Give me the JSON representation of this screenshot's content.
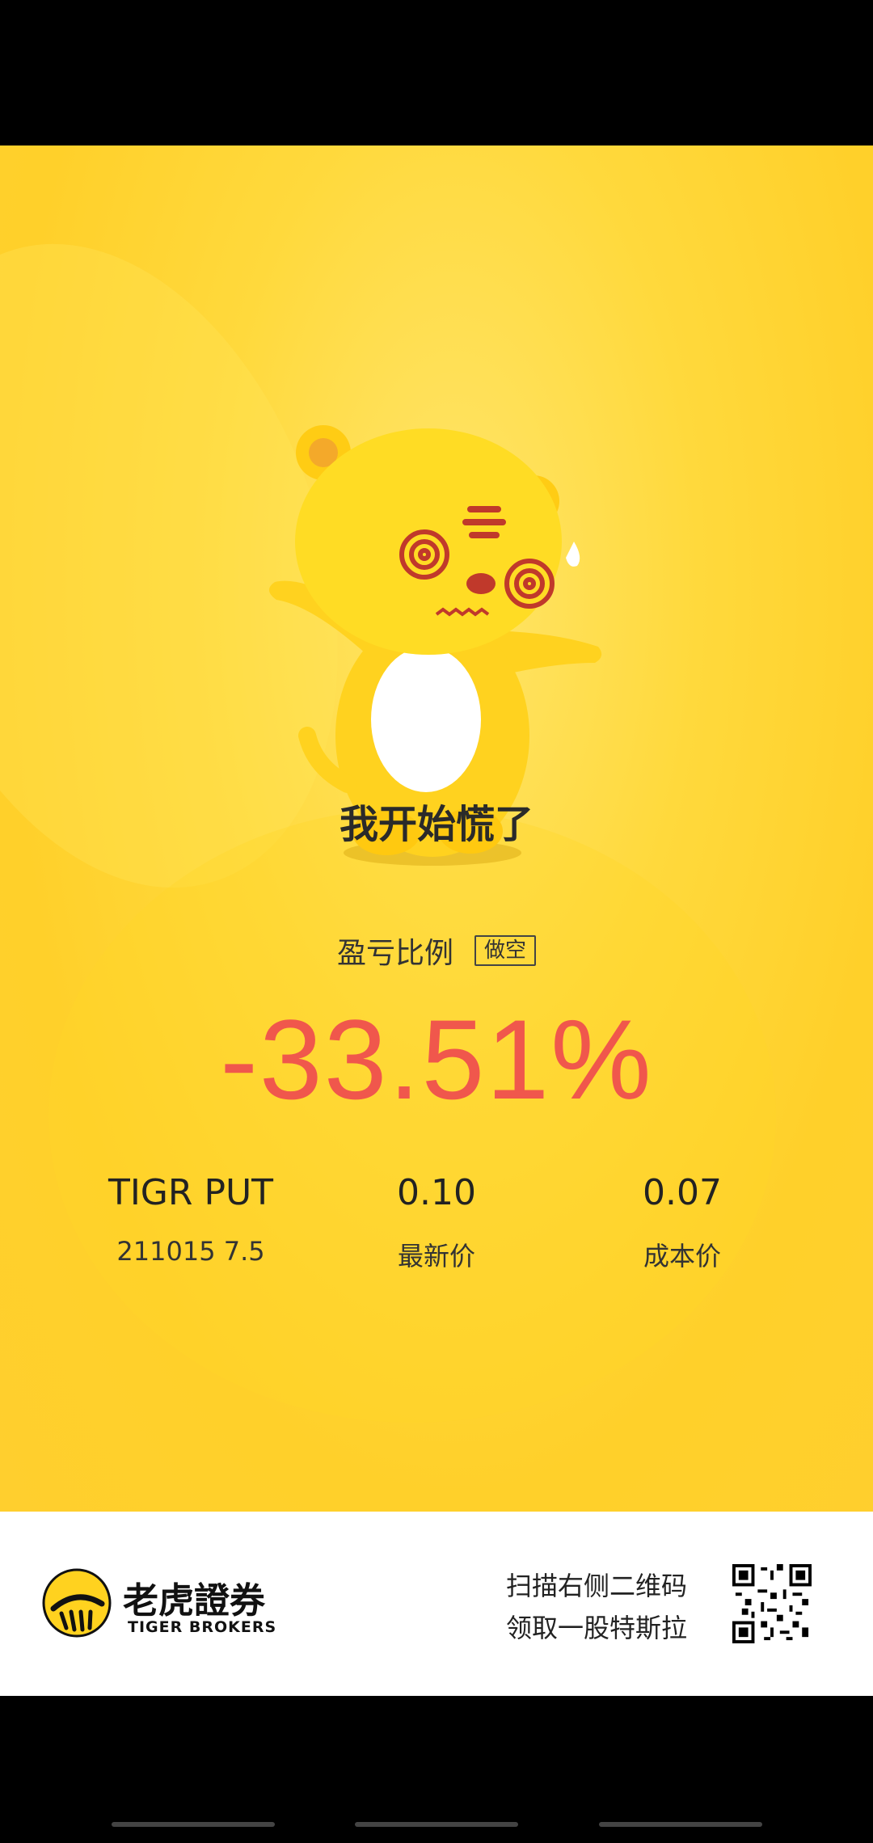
{
  "mood_text": "我开始慌了",
  "ratio_label": "盈亏比例",
  "position_tag": "做空",
  "pnl_percent": "-33.51%",
  "instrument": {
    "symbol": "TIGR PUT",
    "detail": "211015 7.5"
  },
  "latest_price": {
    "value": "0.10",
    "label": "最新价"
  },
  "cost_price": {
    "value": "0.07",
    "label": "成本价"
  },
  "footer": {
    "brand_cn": "老虎證券",
    "brand_en": "TIGER BROKERS",
    "promo_line1": "扫描右侧二维码",
    "promo_line2": "领取一股特斯拉"
  },
  "colors": {
    "accent_red": "#f0574c",
    "card_yellow": "#ffd93c"
  },
  "icons": [
    "tiger-mascot-icon",
    "tiger-logo-icon",
    "qr-code-icon"
  ]
}
